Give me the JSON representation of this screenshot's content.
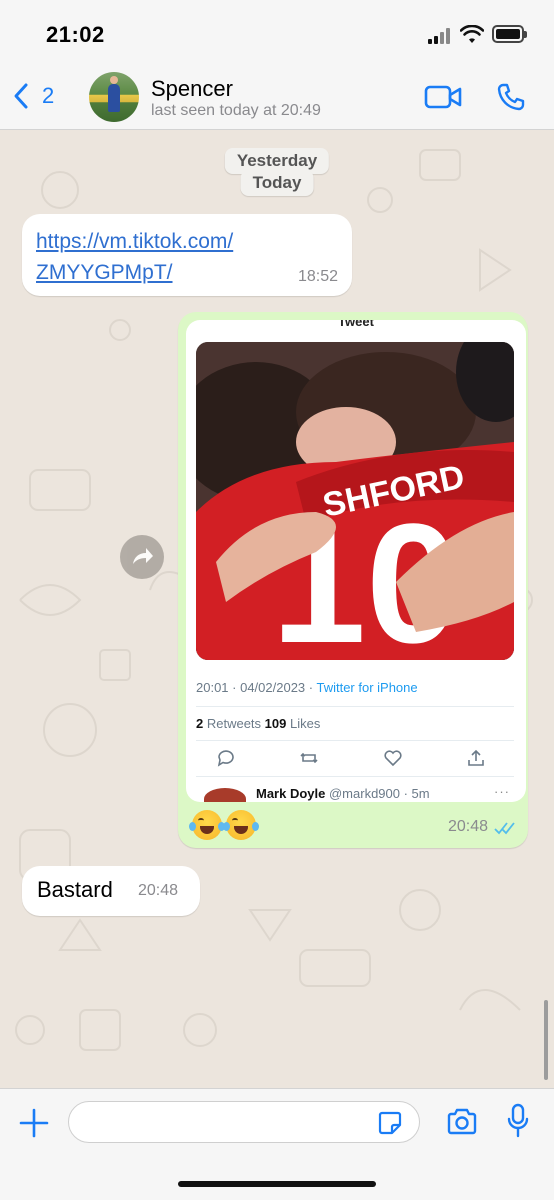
{
  "status_bar": {
    "time": "21:02"
  },
  "header": {
    "back_count": "2",
    "contact_name": "Spencer",
    "last_seen": "last seen today at 20:49"
  },
  "chat": {
    "date_labels": [
      "Yesterday",
      "Today"
    ],
    "messages": [
      {
        "direction": "incoming",
        "type": "link",
        "text": "https://vm.tiktok.com/ZMYYGPMpT/",
        "text_line1": "https://vm.tiktok.com/",
        "text_line2": "ZMYYGPMpT/",
        "time": "18:52"
      },
      {
        "direction": "outgoing",
        "type": "image",
        "tweet": {
          "header_title": "Tweet",
          "timestamp": "20:01 · 04/02/2023 · ",
          "source": "Twitter for iPhone",
          "retweets": "2",
          "retweets_label": " Retweets  ",
          "likes": "109",
          "likes_label": " Likes",
          "reply_author": "Mark Doyle",
          "reply_handle": " @markd900 · 5m",
          "reply_more": "···",
          "shirt_text": "SHFORD",
          "shirt_number": "10"
        },
        "caption_emoji": "😂😂",
        "time": "20:48",
        "read_status": "read"
      },
      {
        "direction": "incoming",
        "type": "text",
        "text": "Bastard",
        "time": "20:48"
      }
    ]
  },
  "input": {
    "placeholder": ""
  },
  "colors": {
    "accent": "#1a7cf5",
    "outgoing_bubble": "#dcf8c6",
    "incoming_bubble": "#ffffff",
    "chat_background": "#ece5dd",
    "read_ticks": "#53bdeb"
  },
  "icons": {
    "back": "chevron-left-icon",
    "video": "video-camera-icon",
    "call": "phone-icon",
    "forward": "forward-arrow-icon",
    "attach": "plus-icon",
    "sticker": "sticker-icon",
    "camera": "camera-icon",
    "mic": "microphone-icon"
  }
}
